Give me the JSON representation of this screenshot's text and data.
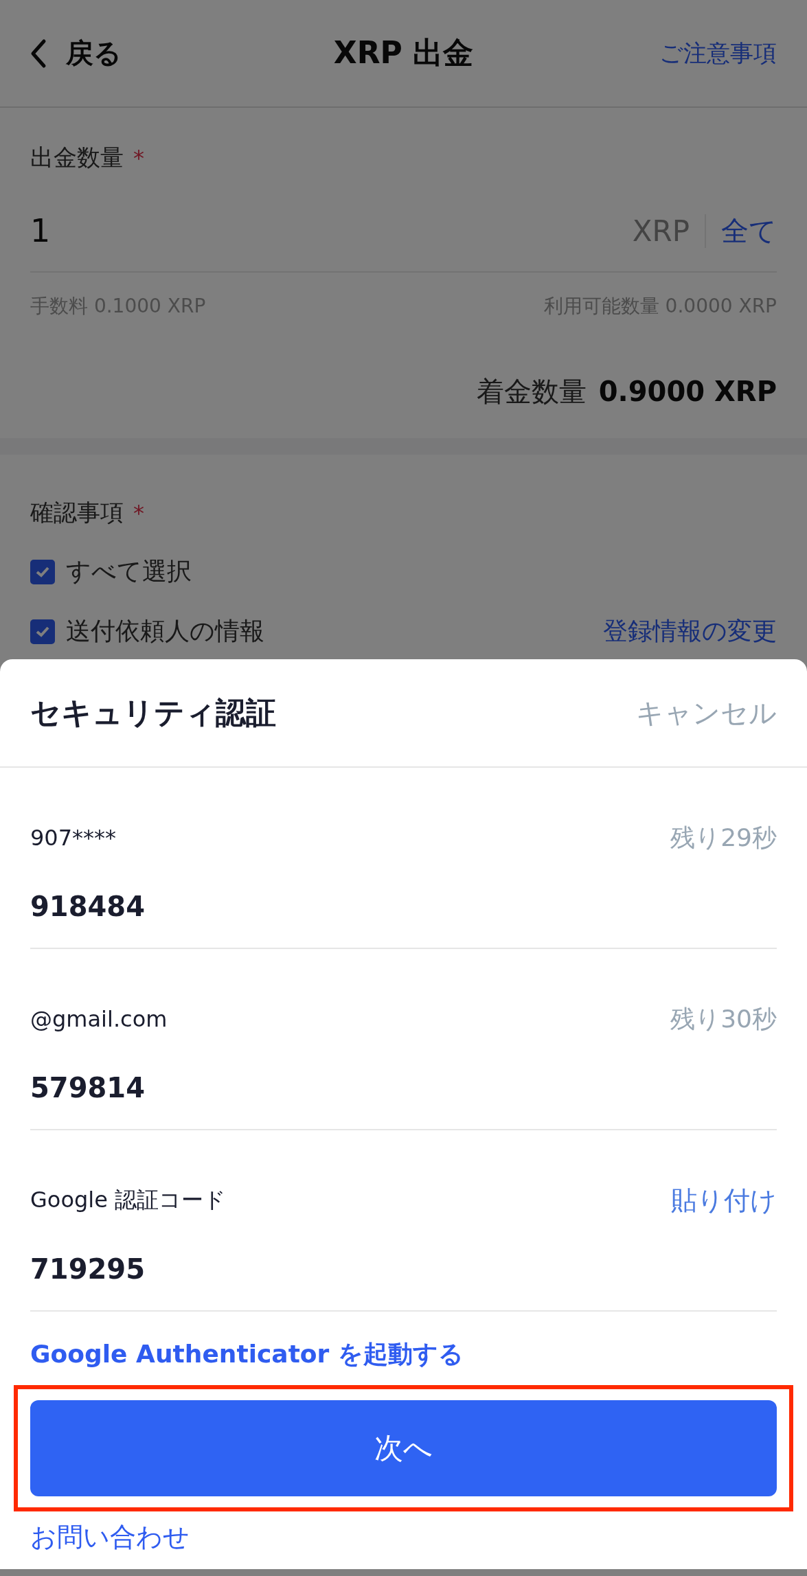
{
  "header": {
    "back": "戻る",
    "title": "XRP 出金",
    "link": "ご注意事項"
  },
  "amount": {
    "label": "出金数量",
    "required_mark": "*",
    "value": "1",
    "unit": "XRP",
    "all_button": "全て",
    "fee": "手数料 0.1000 XRP",
    "available": "利用可能数量 0.0000 XRP",
    "received_label": "着金数量",
    "received_value": "0.9000 XRP"
  },
  "confirmation": {
    "label": "確認事項",
    "required_mark": "*",
    "items": [
      {
        "label": "すべて選択",
        "checked": true
      },
      {
        "label": "送付依頼人の情報",
        "checked": true,
        "link": "登録情報の変更"
      }
    ]
  },
  "dialog": {
    "title": "セキュリティ認証",
    "cancel": "キャンセル",
    "fields": [
      {
        "kind": "timer",
        "label": "907****",
        "action": "残り29秒",
        "value": "918484"
      },
      {
        "kind": "timer",
        "label": "@gmail.com",
        "action": "残り30秒",
        "value": "579814"
      },
      {
        "kind": "paste",
        "label": "Google 認証コード",
        "action": "貼り付け",
        "value": "719295"
      }
    ],
    "authenticator_link": "Google Authenticator を起動する",
    "next_button": {
      "label": "次へ",
      "highlighted": true
    },
    "contact_link": "お問い合わせ"
  }
}
